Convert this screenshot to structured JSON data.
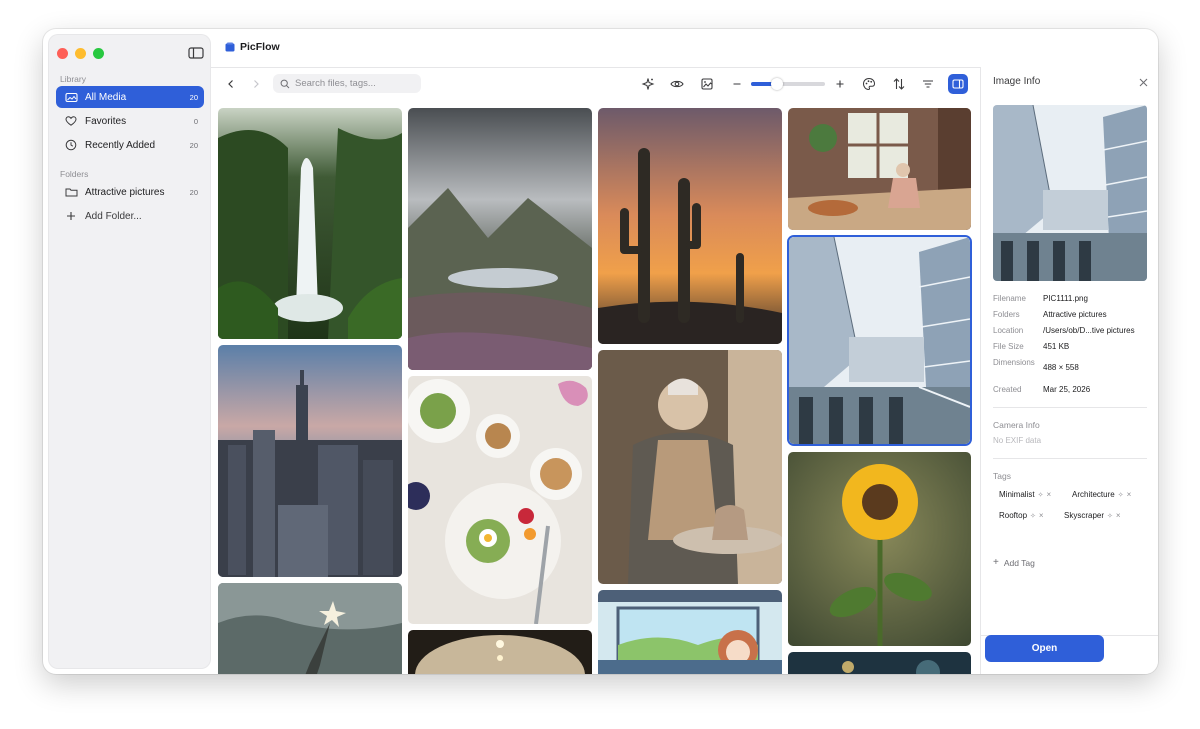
{
  "app": {
    "title": "PicFlow",
    "accent": "#2f5fd9"
  },
  "sidebar": {
    "library_label": "Library",
    "items": [
      {
        "label": "All Media",
        "count": "20",
        "icon": "photo-library-icon",
        "active": true
      },
      {
        "label": "Favorites",
        "count": "0",
        "icon": "heart-icon"
      },
      {
        "label": "Recently Added",
        "count": "20",
        "icon": "clock-icon"
      }
    ],
    "folders_label": "Folders",
    "folders": [
      {
        "label": "Attractive pictures",
        "count": "20",
        "icon": "folder-icon"
      }
    ],
    "add_folder_label": "Add Folder..."
  },
  "toolbar": {
    "search_placeholder": "Search files, tags...",
    "zoom_level": 0.35,
    "icons": [
      "back-icon",
      "forward-icon",
      "search-icon",
      "sparkle-icon",
      "eye-icon",
      "image-icon",
      "minus-icon",
      "plus-icon",
      "palette-icon",
      "sort-icon",
      "filter-icon",
      "panel-icon"
    ]
  },
  "gallery": {
    "images": [
      {
        "subject": "waterfall"
      },
      {
        "subject": "mountain-lake"
      },
      {
        "subject": "desert-cactus"
      },
      {
        "subject": "reading-room"
      },
      {
        "subject": "city-skyline"
      },
      {
        "subject": "breakfast"
      },
      {
        "subject": "potter"
      },
      {
        "subject": "glass-building",
        "selected": true
      },
      {
        "subject": "statue"
      },
      {
        "subject": "cafe-lights"
      },
      {
        "subject": "anime-train"
      },
      {
        "subject": "sunflower"
      },
      {
        "subject": "bokeh"
      }
    ]
  },
  "info_panel": {
    "title": "Image Info",
    "metadata": [
      {
        "key": "Filename",
        "value": "PIC1111.png"
      },
      {
        "key": "Folders",
        "value": "Attractive pictures"
      },
      {
        "key": "Location",
        "value": "/Users/ob/D...tive pictures"
      },
      {
        "key": "File Size",
        "value": "451 KB"
      },
      {
        "key": "Dimensions",
        "value": "488 × 558"
      },
      {
        "key": "Created",
        "value": "Mar 25, 2026"
      }
    ],
    "camera_label": "Camera Info",
    "camera_value": "No EXIF data",
    "tags_label": "Tags",
    "tags": [
      "Minimalist",
      "Architecture",
      "Rooftop",
      "Skyscraper"
    ],
    "add_tag_label": "Add Tag",
    "open_label": "Open"
  }
}
